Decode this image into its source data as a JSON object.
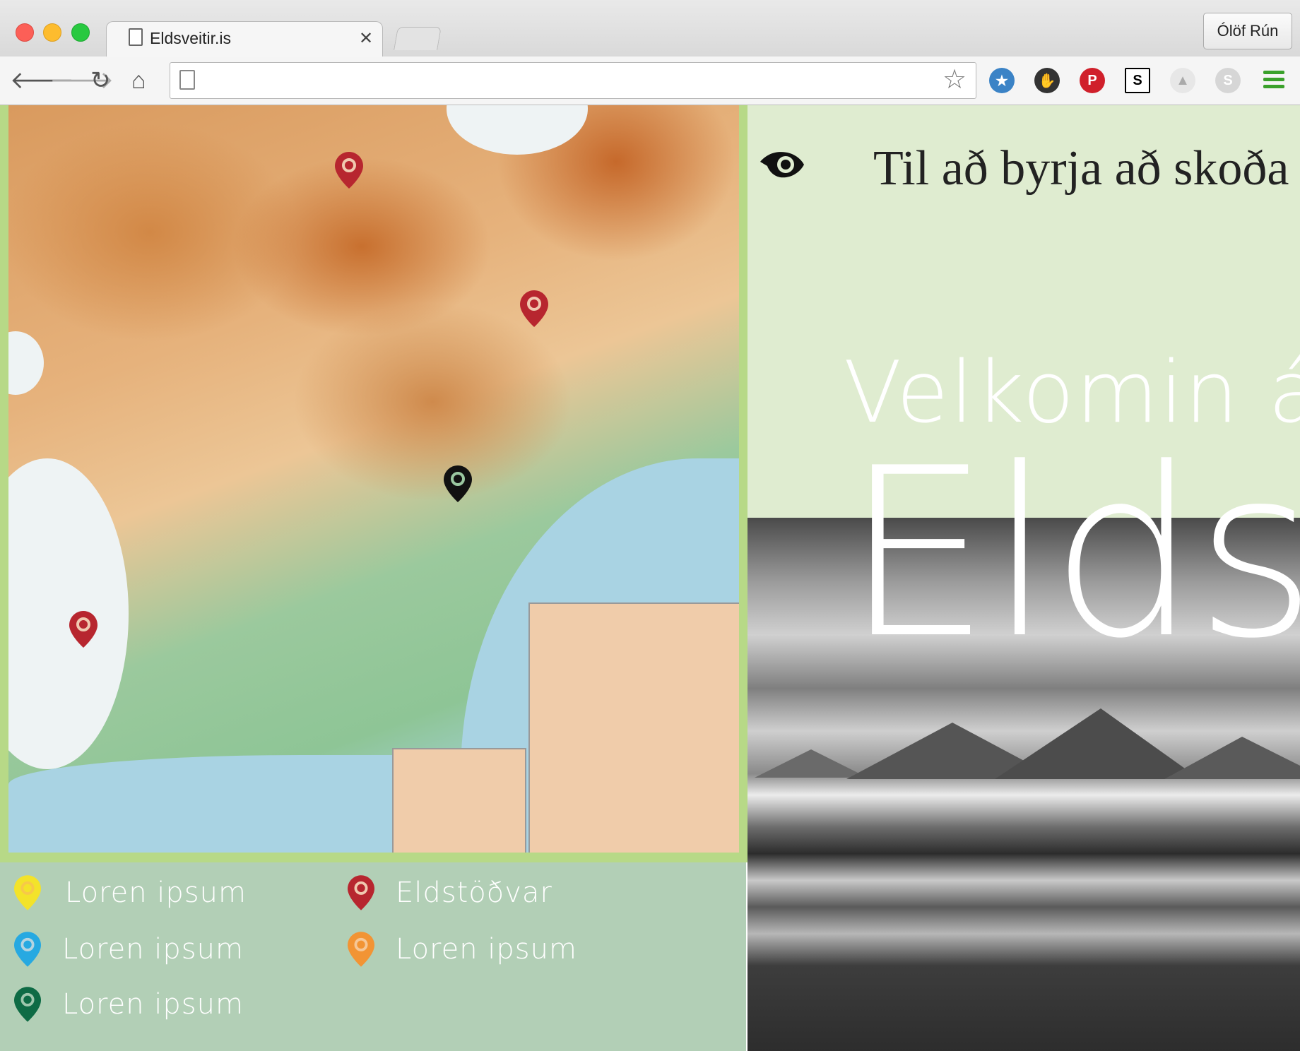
{
  "browser": {
    "tab_title": "Eldsveitir.is",
    "profile_name": "Ólöf Rún",
    "address": "",
    "extensions": [
      "star-badge-icon",
      "hand-icon",
      "pinterest-icon",
      "s-box-icon",
      "ghost-icon",
      "skype-icon"
    ]
  },
  "header": {
    "intro_text": "Til að byrja að skoða"
  },
  "hero": {
    "welcome": "Velkomin á",
    "site_title": "Eldsv"
  },
  "legend": {
    "items": [
      {
        "label": "Loren ipsum",
        "color": "#f3e32a"
      },
      {
        "label": "Eldstöðvar",
        "color": "#b7262f"
      },
      {
        "label": "Loren ipsum",
        "color": "#27a9e1"
      },
      {
        "label": "Loren ipsum",
        "color": "#f29434"
      },
      {
        "label": "Loren ipsum",
        "color": "#0e6b45"
      }
    ]
  },
  "colors": {
    "accent_green": "#b7d987",
    "legend_bg": "#b2cfb6",
    "hero_bg": "#dfecd0",
    "volcano_pin": "#b7262f"
  }
}
